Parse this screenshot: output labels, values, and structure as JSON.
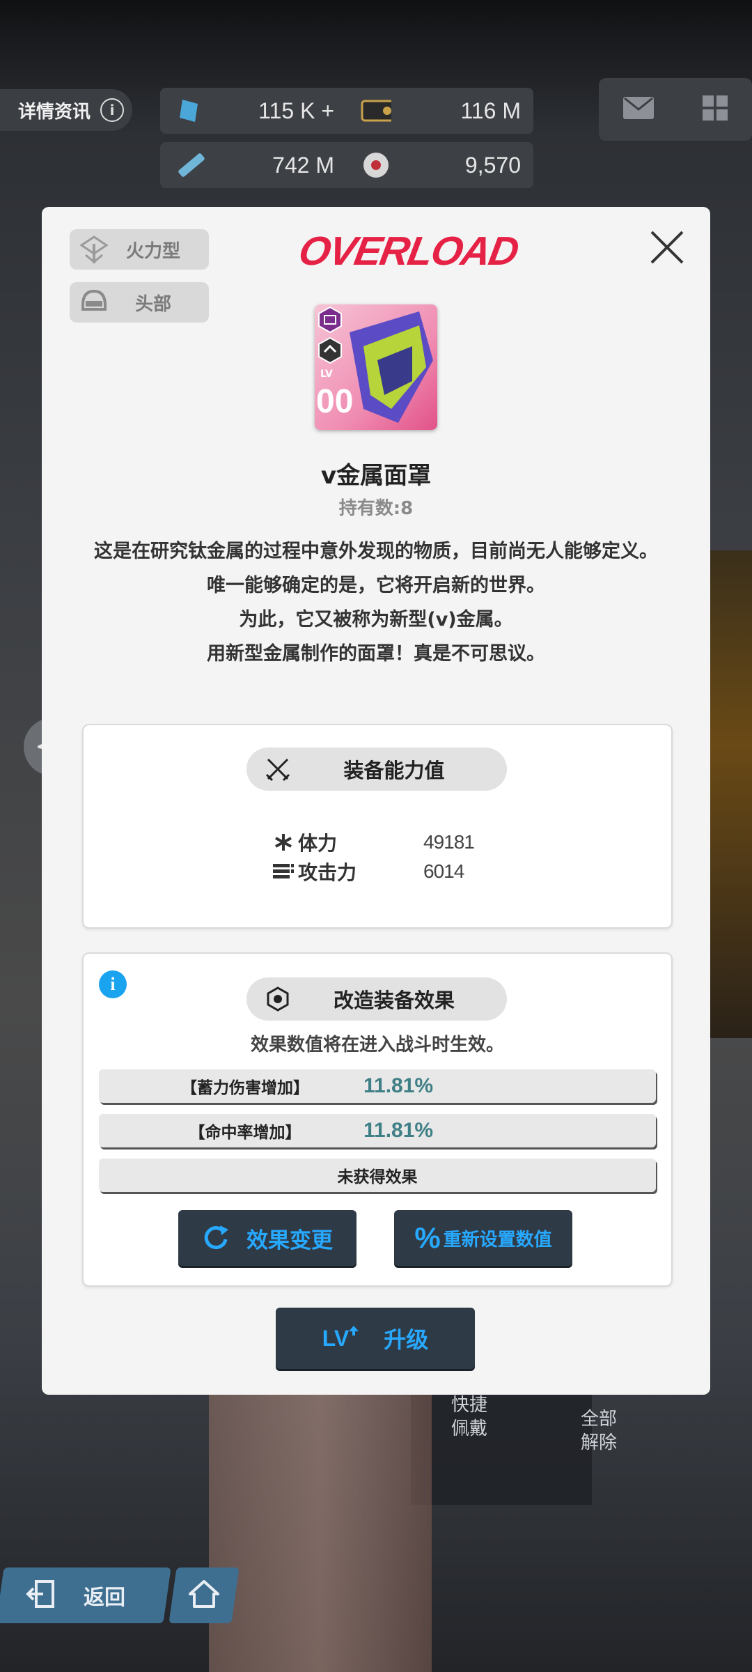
{
  "background": {
    "info_label": "详情资讯",
    "resources": [
      {
        "icon": "crystal-icon",
        "value": "115 K +"
      },
      {
        "icon": "credit-card-icon",
        "value": "116 M"
      },
      {
        "icon": "battery-data-icon",
        "value": "742 M"
      },
      {
        "icon": "core-dust-icon",
        "value": "9,570"
      }
    ],
    "quick_equip": "快捷\n佩戴",
    "unequip_all": "全部\n解除",
    "back_label": "返回"
  },
  "modal": {
    "tags": [
      {
        "icon": "firepower-class-icon",
        "label": "火力型"
      },
      {
        "icon": "head-slot-icon",
        "label": "头部"
      }
    ],
    "logo_text": "OVERLOAD",
    "item": {
      "level_prefix": "LV",
      "level": "00",
      "name": "v金属面罩",
      "owned": "持有数:8"
    },
    "description": [
      "这是在研究钛金属的过程中意外发现的物质，目前尚无人能够定义。",
      "唯一能够确定的是，它将开启新的世界。",
      "为此，它又被称为新型(v)金属。",
      "用新型金属制作的面罩！真是不可思议。"
    ],
    "stats": {
      "title": "装备能力值",
      "rows": [
        {
          "icon": "asterisk-icon",
          "label": "体力",
          "value": "49181"
        },
        {
          "icon": "ammo-icon",
          "label": "攻击力",
          "value": "6014"
        }
      ]
    },
    "effects": {
      "title": "改造装备效果",
      "note": "效果数值将在进入战斗时生效。",
      "rows": [
        {
          "name": "【蓄力伤害增加】",
          "value": "11.81%"
        },
        {
          "name": "【命中率增加】",
          "value": "11.81%"
        },
        {
          "name": "未获得效果",
          "value": ""
        }
      ],
      "change_label": "效果变更",
      "reset_label": "重新设置数值"
    },
    "upgrade": {
      "prefix": "LV",
      "label": "升级"
    }
  }
}
